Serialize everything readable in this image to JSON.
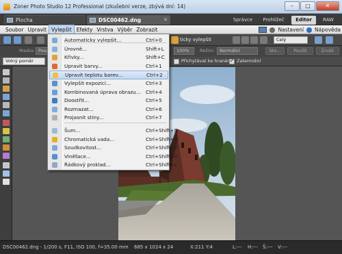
{
  "window": {
    "title": "Zoner Photo Studio 12 Professional (zkušební verze, zbývá dní: 14)",
    "minimize": "–",
    "maximize": "□",
    "close": "✕"
  },
  "tabs": [
    {
      "label": "Plocha"
    },
    {
      "label": "DSC00462.dng"
    }
  ],
  "modes": [
    "Správce",
    "Prohlížeč",
    "Editor",
    "RAW"
  ],
  "active_mode": "Editor",
  "menubar": {
    "items": [
      "Soubor",
      "Upravit",
      "Vylepšit",
      "Efekty",
      "Vrstva",
      "Výběr",
      "Zobrazit"
    ],
    "settings": "Nastavení",
    "help": "Nápověda"
  },
  "toolbar": {
    "auto_label": "ticky vylepšit",
    "preset": "Celý",
    "mask_label": "Maska:",
    "mask_value": "Pouz",
    "zoom": "100%",
    "mode_label": "Režim:",
    "mode_value": "Normální",
    "btn_sto": "Sto...",
    "btn_pouzit": "Použít",
    "btn_zrusit": "Zrušit",
    "ratio": "Volný poměr",
    "snap_edges": "Přichytávat ke hranám",
    "darken": "Zatemnění"
  },
  "menu": {
    "items": [
      {
        "label": "Automaticky vylepšit...",
        "shortcut": "Ctrl+0",
        "icon": "magic-wand-icon"
      },
      {
        "label": "Úrovně...",
        "shortcut": "Shift+L",
        "icon": "levels-icon"
      },
      {
        "label": "Křivky...",
        "shortcut": "Shift+C",
        "icon": "curves-icon"
      },
      {
        "label": "Upravit barvy...",
        "shortcut": "Ctrl+1",
        "icon": "color-palette-icon"
      },
      {
        "label": "Upravit teplotu barev...",
        "shortcut": "Ctrl+2",
        "icon": "thermometer-icon"
      },
      {
        "label": "Vylepšit expozici...",
        "shortcut": "Ctrl+3",
        "icon": "exposure-icon"
      },
      {
        "label": "Kombinovaná úprava obrazu...",
        "shortcut": "Ctrl+4",
        "icon": "combined-adjust-icon"
      },
      {
        "label": "Doostřit...",
        "shortcut": "Ctrl+5",
        "icon": "sharpen-icon"
      },
      {
        "label": "Rozmazat...",
        "shortcut": "Ctrl+6",
        "icon": "blur-icon"
      },
      {
        "label": "Projasnit stíny...",
        "shortcut": "Ctrl+7",
        "icon": "shadows-icon"
      },
      {
        "label": "Šum...",
        "shortcut": "Ctrl+Shift+N",
        "icon": "noise-icon"
      },
      {
        "label": "Chromatická vada...",
        "shortcut": "Ctrl+Shift+A",
        "icon": "star-icon"
      },
      {
        "label": "Soudkovitost...",
        "shortcut": "Ctrl+Shift+D",
        "icon": "grid-icon"
      },
      {
        "label": "Viněťace...",
        "shortcut": "Ctrl+Shift+V",
        "icon": "vignette-icon"
      },
      {
        "label": "Řádkový proklad...",
        "shortcut": "Ctrl+Shift+L",
        "icon": "interlace-icon"
      }
    ],
    "highlighted": "Upravit teplotu barev..."
  },
  "status": {
    "file_info": "DSC00462.dng - 1/200 s, F11, ISO 100, f=35.00 mm",
    "dimensions": "685 x 1024 x 24",
    "coords": "X:211  Y:4",
    "l": "L:---",
    "h": "H:---",
    "s": "Š:---",
    "v": "V:---"
  },
  "colors": {
    "accent": "#c3d7f0",
    "editor_active": "#d8d8d8",
    "background": "#555555"
  }
}
